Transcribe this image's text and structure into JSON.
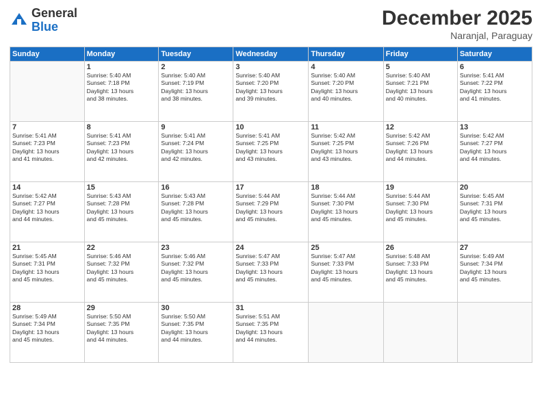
{
  "logo": {
    "general": "General",
    "blue": "Blue"
  },
  "title": {
    "month": "December 2025",
    "location": "Naranjal, Paraguay"
  },
  "headers": [
    "Sunday",
    "Monday",
    "Tuesday",
    "Wednesday",
    "Thursday",
    "Friday",
    "Saturday"
  ],
  "weeks": [
    [
      {
        "day": "",
        "info": ""
      },
      {
        "day": "1",
        "info": "Sunrise: 5:40 AM\nSunset: 7:18 PM\nDaylight: 13 hours\nand 38 minutes."
      },
      {
        "day": "2",
        "info": "Sunrise: 5:40 AM\nSunset: 7:19 PM\nDaylight: 13 hours\nand 38 minutes."
      },
      {
        "day": "3",
        "info": "Sunrise: 5:40 AM\nSunset: 7:20 PM\nDaylight: 13 hours\nand 39 minutes."
      },
      {
        "day": "4",
        "info": "Sunrise: 5:40 AM\nSunset: 7:20 PM\nDaylight: 13 hours\nand 40 minutes."
      },
      {
        "day": "5",
        "info": "Sunrise: 5:40 AM\nSunset: 7:21 PM\nDaylight: 13 hours\nand 40 minutes."
      },
      {
        "day": "6",
        "info": "Sunrise: 5:41 AM\nSunset: 7:22 PM\nDaylight: 13 hours\nand 41 minutes."
      }
    ],
    [
      {
        "day": "7",
        "info": "Sunrise: 5:41 AM\nSunset: 7:23 PM\nDaylight: 13 hours\nand 41 minutes."
      },
      {
        "day": "8",
        "info": "Sunrise: 5:41 AM\nSunset: 7:23 PM\nDaylight: 13 hours\nand 42 minutes."
      },
      {
        "day": "9",
        "info": "Sunrise: 5:41 AM\nSunset: 7:24 PM\nDaylight: 13 hours\nand 42 minutes."
      },
      {
        "day": "10",
        "info": "Sunrise: 5:41 AM\nSunset: 7:25 PM\nDaylight: 13 hours\nand 43 minutes."
      },
      {
        "day": "11",
        "info": "Sunrise: 5:42 AM\nSunset: 7:25 PM\nDaylight: 13 hours\nand 43 minutes."
      },
      {
        "day": "12",
        "info": "Sunrise: 5:42 AM\nSunset: 7:26 PM\nDaylight: 13 hours\nand 44 minutes."
      },
      {
        "day": "13",
        "info": "Sunrise: 5:42 AM\nSunset: 7:27 PM\nDaylight: 13 hours\nand 44 minutes."
      }
    ],
    [
      {
        "day": "14",
        "info": "Sunrise: 5:42 AM\nSunset: 7:27 PM\nDaylight: 13 hours\nand 44 minutes."
      },
      {
        "day": "15",
        "info": "Sunrise: 5:43 AM\nSunset: 7:28 PM\nDaylight: 13 hours\nand 45 minutes."
      },
      {
        "day": "16",
        "info": "Sunrise: 5:43 AM\nSunset: 7:28 PM\nDaylight: 13 hours\nand 45 minutes."
      },
      {
        "day": "17",
        "info": "Sunrise: 5:44 AM\nSunset: 7:29 PM\nDaylight: 13 hours\nand 45 minutes."
      },
      {
        "day": "18",
        "info": "Sunrise: 5:44 AM\nSunset: 7:30 PM\nDaylight: 13 hours\nand 45 minutes."
      },
      {
        "day": "19",
        "info": "Sunrise: 5:44 AM\nSunset: 7:30 PM\nDaylight: 13 hours\nand 45 minutes."
      },
      {
        "day": "20",
        "info": "Sunrise: 5:45 AM\nSunset: 7:31 PM\nDaylight: 13 hours\nand 45 minutes."
      }
    ],
    [
      {
        "day": "21",
        "info": "Sunrise: 5:45 AM\nSunset: 7:31 PM\nDaylight: 13 hours\nand 45 minutes."
      },
      {
        "day": "22",
        "info": "Sunrise: 5:46 AM\nSunset: 7:32 PM\nDaylight: 13 hours\nand 45 minutes."
      },
      {
        "day": "23",
        "info": "Sunrise: 5:46 AM\nSunset: 7:32 PM\nDaylight: 13 hours\nand 45 minutes."
      },
      {
        "day": "24",
        "info": "Sunrise: 5:47 AM\nSunset: 7:33 PM\nDaylight: 13 hours\nand 45 minutes."
      },
      {
        "day": "25",
        "info": "Sunrise: 5:47 AM\nSunset: 7:33 PM\nDaylight: 13 hours\nand 45 minutes."
      },
      {
        "day": "26",
        "info": "Sunrise: 5:48 AM\nSunset: 7:33 PM\nDaylight: 13 hours\nand 45 minutes."
      },
      {
        "day": "27",
        "info": "Sunrise: 5:49 AM\nSunset: 7:34 PM\nDaylight: 13 hours\nand 45 minutes."
      }
    ],
    [
      {
        "day": "28",
        "info": "Sunrise: 5:49 AM\nSunset: 7:34 PM\nDaylight: 13 hours\nand 45 minutes."
      },
      {
        "day": "29",
        "info": "Sunrise: 5:50 AM\nSunset: 7:35 PM\nDaylight: 13 hours\nand 44 minutes."
      },
      {
        "day": "30",
        "info": "Sunrise: 5:50 AM\nSunset: 7:35 PM\nDaylight: 13 hours\nand 44 minutes."
      },
      {
        "day": "31",
        "info": "Sunrise: 5:51 AM\nSunset: 7:35 PM\nDaylight: 13 hours\nand 44 minutes."
      },
      {
        "day": "",
        "info": ""
      },
      {
        "day": "",
        "info": ""
      },
      {
        "day": "",
        "info": ""
      }
    ]
  ]
}
